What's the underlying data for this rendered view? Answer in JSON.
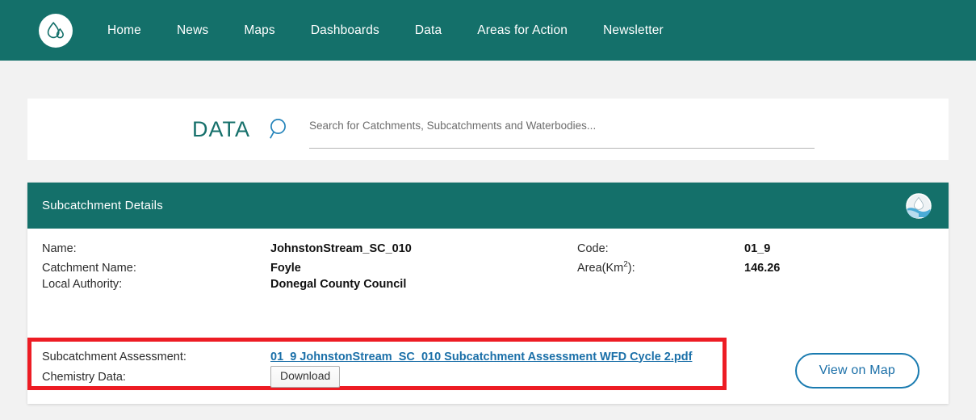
{
  "colors": {
    "teal": "#14706a",
    "link_blue": "#1a6fa8",
    "highlight_red": "#ed1c24",
    "page_bg": "#f2f2f2"
  },
  "topnav": {
    "logo_icon": "water-droplet-logo-icon",
    "items": [
      {
        "label": "Home"
      },
      {
        "label": "News"
      },
      {
        "label": "Maps"
      },
      {
        "label": "Dashboards"
      },
      {
        "label": "Data"
      },
      {
        "label": "Areas for Action"
      },
      {
        "label": "Newsletter"
      }
    ]
  },
  "search": {
    "section_label": "DATA",
    "icon": "search-icon",
    "placeholder": "Search for Catchments, Subcatchments and Waterbodies...",
    "value": ""
  },
  "details": {
    "title": "Subcatchment Details",
    "header_icon": "water-catchment-circle-icon",
    "fields": [
      {
        "left_label": "Name:",
        "left_value": "JohnstonStream_SC_010",
        "right_label": "Code:",
        "right_value": "01_9"
      },
      {
        "left_label": "Catchment Name:",
        "left_value": "Foyle",
        "right_label": "Area(Km",
        "right_label_sup": "2",
        "right_label_end": "):",
        "right_value": "146.26"
      },
      {
        "left_label": "Local Authority:",
        "left_value": "Donegal County Council",
        "right_label": "",
        "right_value": ""
      }
    ],
    "highlighted": {
      "assessment_label": "Subcatchment Assessment:",
      "assessment_link": "01_9 JohnstonStream_SC_010 Subcatchment Assessment WFD Cycle 2.pdf",
      "chemistry_label": "Chemistry Data:",
      "download_label": "Download"
    },
    "view_on_map_label": "View on Map"
  }
}
